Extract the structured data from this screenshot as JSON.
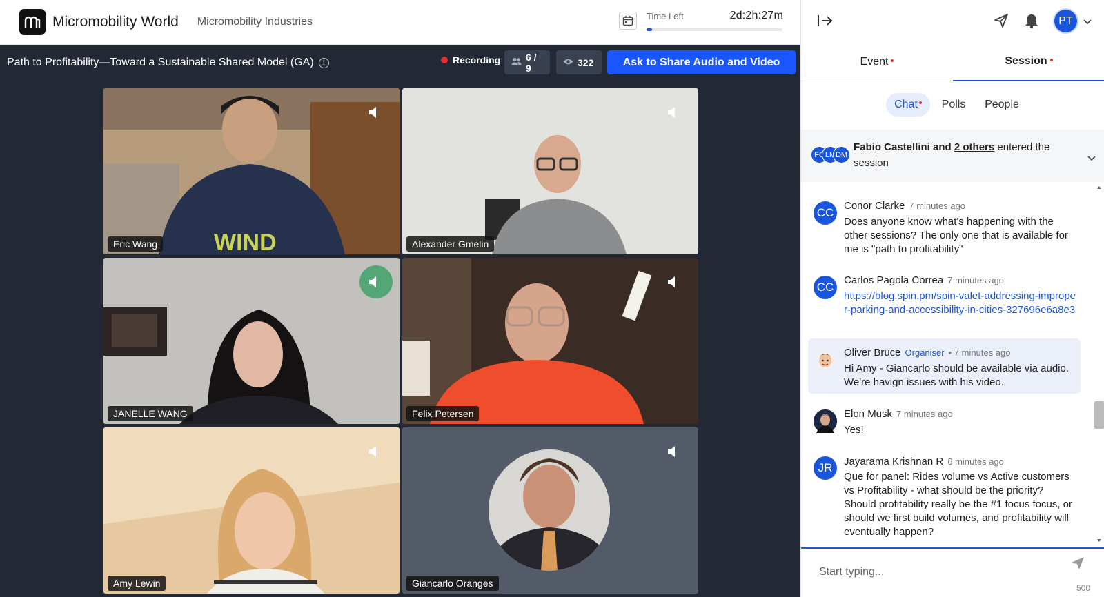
{
  "topbar": {
    "app_title": "Micromobility World",
    "org_name": "Micromobility Industries",
    "time_label": "Time Left",
    "time_value": "2d:2h:27m",
    "time_progress_fraction": 0.04
  },
  "stage": {
    "session_title": "Path to Profitability—Toward a Sustainable Shared Model (GA)",
    "recording_label": "Recording",
    "participants_count": "6 / 9",
    "viewers_count": "322",
    "share_button_label": "Ask to Share Audio and Video",
    "tiles": [
      {
        "name": "Eric Wang"
      },
      {
        "name": "Alexander Gmelin"
      },
      {
        "name": "JANELLE WANG"
      },
      {
        "name": "Felix Petersen"
      },
      {
        "name": "Amy Lewin"
      },
      {
        "name": "Giancarlo Oranges"
      }
    ]
  },
  "sidebar": {
    "tabs": [
      {
        "label": "Event"
      },
      {
        "label": "Session"
      }
    ],
    "subtabs": [
      {
        "label": "Chat"
      },
      {
        "label": "Polls"
      },
      {
        "label": "People"
      }
    ],
    "user_initials": "PT",
    "entered": {
      "avatars": [
        "FC",
        "LM",
        "DM"
      ],
      "name": "Fabio Castellini",
      "and": "and",
      "others": "2 others",
      "rest": "entered the session"
    },
    "messages": [
      {
        "initials": "CC",
        "name": "Conor Clarke",
        "time": "7 minutes ago",
        "body": "Does anyone know what's happening with the other sessions? The only one that is available for me is \"path to profitability\""
      },
      {
        "initials": "CC",
        "name": "Carlos Pagola Correa",
        "time": "7 minutes ago",
        "body": "https://blog.spin.pm/spin-valet-addressing-improper-parking-and-accessibility-in-cities-327696e6a8e3"
      },
      {
        "initials": "",
        "name": "Oliver Bruce",
        "role": "Organiser",
        "time": "• 7 minutes ago",
        "body": "Hi Amy - Giancarlo should be available via audio. We're havign issues with his video."
      },
      {
        "initials": "",
        "name": "Elon Musk",
        "time": "7 minutes ago",
        "body": "Yes!"
      },
      {
        "initials": "JR",
        "name": "Jayarama Krishnan R",
        "time": "6 minutes ago",
        "body": "Que for panel: Rides volume vs Active customers vs Profitability - what should be the priority? Should profitability really be the #1 focus focus, or should we first build volumes, and profitability will eventually happen?"
      }
    ],
    "composer_placeholder": "Start typing...",
    "char_limit": "500"
  },
  "colors": {
    "accent": "#1a56db",
    "stage_bg": "#232835",
    "record_red": "#e0302d",
    "active_speaker": "#55a677"
  }
}
